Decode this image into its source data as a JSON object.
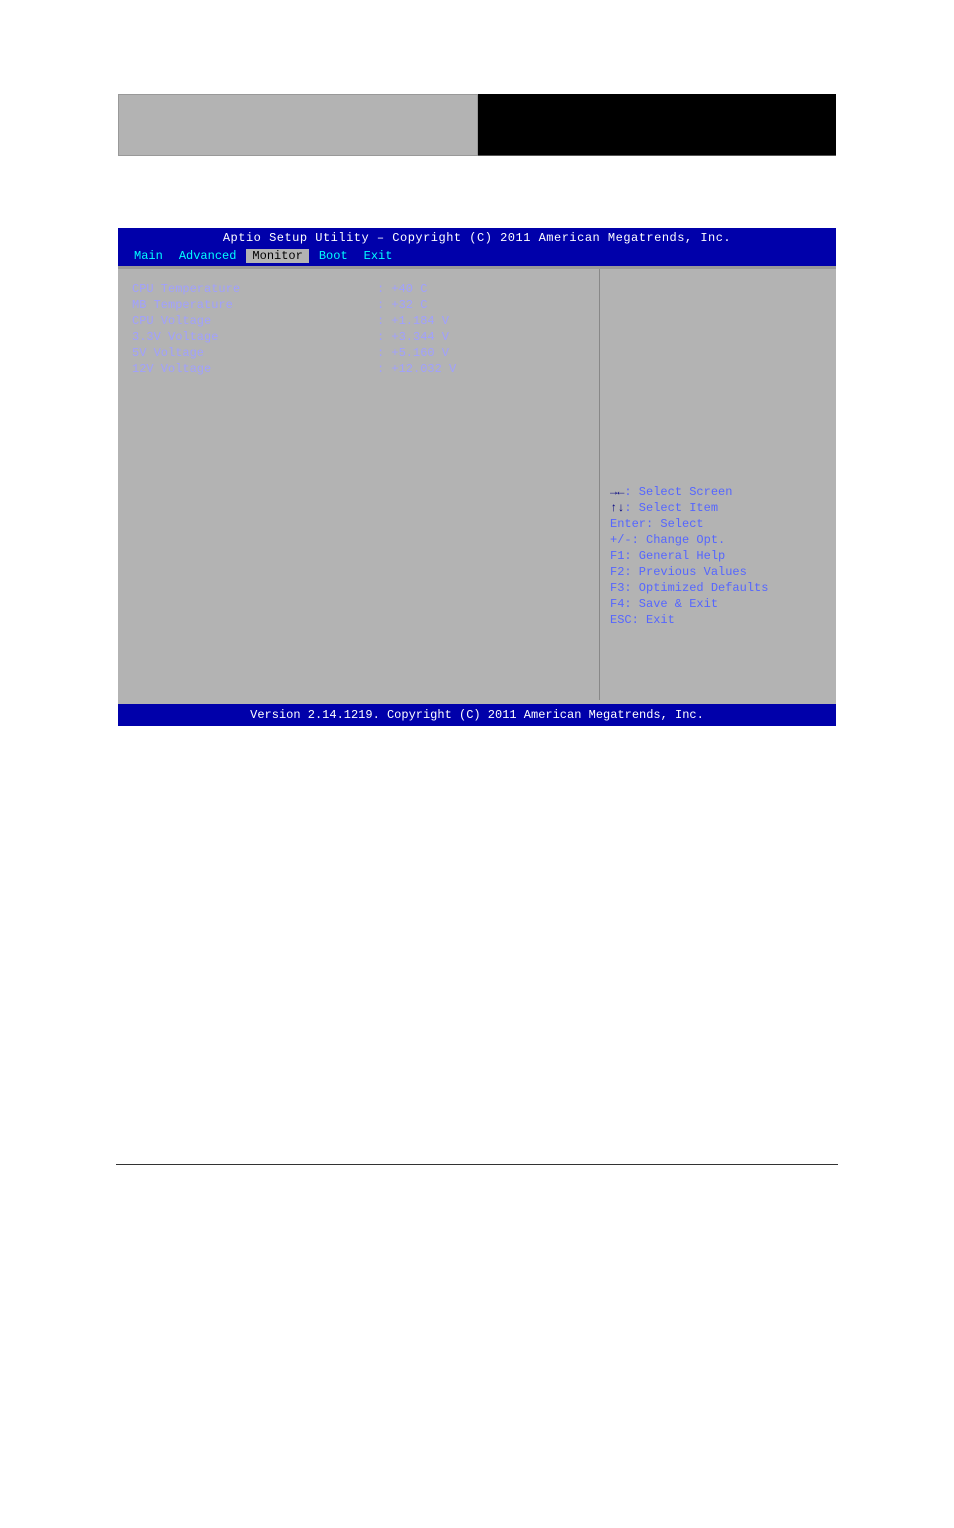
{
  "header": {
    "title": "Aptio Setup Utility – Copyright (C) 2011 American Megatrends, Inc."
  },
  "tabs": {
    "main": "Main",
    "advanced": "Advanced",
    "monitor": "Monitor",
    "boot": "Boot",
    "exit": "Exit"
  },
  "monitor": {
    "rows": [
      {
        "label": "CPU Temperature",
        "value": ": +40 C"
      },
      {
        "label": "MB Temperature",
        "value": ": +32 C"
      },
      {
        "label": "CPU Voltage",
        "value": ": +1.184 V"
      },
      {
        "label": "3.3V Voltage",
        "value": ": +3.344 V"
      },
      {
        "label": "5V Voltage",
        "value": ": +5.160 V"
      },
      {
        "label": "12V Voltage",
        "value": ": +12.032 V"
      }
    ]
  },
  "help": {
    "line1_prefix": "→←",
    "line1": ": Select Screen",
    "line2_prefix": "↑↓",
    "line2": ": Select Item",
    "line3": "Enter: Select",
    "line4": "+/-: Change Opt.",
    "line5": "F1: General Help",
    "line6": "F2: Previous Values",
    "line7": "F3: Optimized Defaults",
    "line8": "F4: Save & Exit",
    "line9": "ESC: Exit"
  },
  "footer": {
    "version": "Version 2.14.1219. Copyright (C) 2011 American Megatrends, Inc."
  }
}
